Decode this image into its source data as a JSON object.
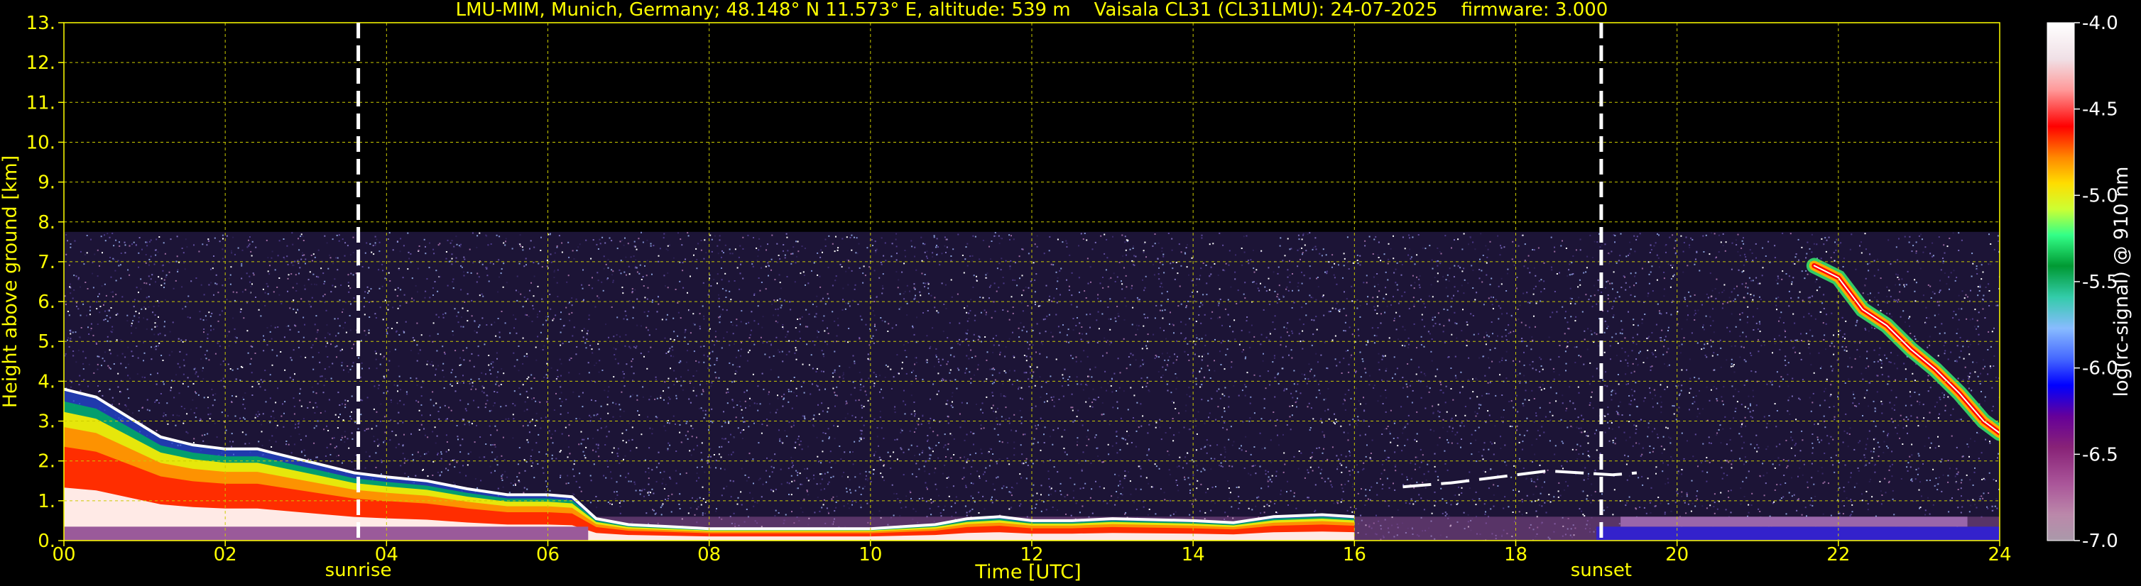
{
  "chart_data": {
    "type": "heatmap",
    "title": "LMU-MIM, Munich, Germany; 48.148° N 11.573° E, altitude: 539 m    Vaisala CL31 (CL31LMU): 24-07-2025    firmware: 3.000",
    "xlabel": "Time [UTC]",
    "ylabel": "Height above ground [km]",
    "xlim": [
      0,
      24
    ],
    "ylim": [
      0,
      13
    ],
    "x_ticks": [
      "00",
      "02",
      "04",
      "06",
      "08",
      "10",
      "12",
      "14",
      "16",
      "18",
      "20",
      "22",
      "24"
    ],
    "y_ticks": [
      "0.",
      "1.",
      "2.",
      "3.",
      "4.",
      "5.",
      "6.",
      "7.",
      "8.",
      "9.",
      "10.",
      "11.",
      "12.",
      "13."
    ],
    "grid": true,
    "annotations": [
      {
        "label": "sunrise",
        "x": 3.65
      },
      {
        "label": "sunset",
        "x": 19.06
      }
    ],
    "colorbar": {
      "label": "log(rc-signal) @ 910 nm",
      "range": [
        -7.0,
        -4.0
      ],
      "ticks": [
        "-4.0",
        "-4.5",
        "-5.0",
        "-5.5",
        "-6.0",
        "-6.5",
        "-7.0"
      ]
    },
    "noise_top_km": 7.75,
    "boundary_layer": [
      [
        0,
        3.8
      ],
      [
        0.4,
        3.6
      ],
      [
        0.8,
        3.1
      ],
      [
        1.2,
        2.6
      ],
      [
        1.6,
        2.4
      ],
      [
        2.0,
        2.3
      ],
      [
        2.4,
        2.3
      ],
      [
        2.8,
        2.1
      ],
      [
        3.2,
        1.9
      ],
      [
        3.6,
        1.7
      ],
      [
        4.0,
        1.6
      ],
      [
        4.5,
        1.5
      ],
      [
        5.0,
        1.3
      ],
      [
        5.5,
        1.15
      ],
      [
        6.0,
        1.15
      ],
      [
        6.3,
        1.1
      ],
      [
        6.6,
        0.55
      ],
      [
        7.0,
        0.4
      ],
      [
        7.5,
        0.35
      ],
      [
        8.0,
        0.3
      ],
      [
        9.0,
        0.3
      ],
      [
        10.0,
        0.3
      ],
      [
        10.8,
        0.4
      ],
      [
        11.2,
        0.55
      ],
      [
        11.6,
        0.6
      ],
      [
        12.0,
        0.5
      ],
      [
        12.5,
        0.5
      ],
      [
        13.0,
        0.55
      ],
      [
        14.0,
        0.5
      ],
      [
        14.5,
        0.45
      ],
      [
        15.0,
        0.6
      ],
      [
        15.6,
        0.65
      ],
      [
        16.0,
        0.6
      ]
    ],
    "residual_layer": [
      [
        16.6,
        1.35
      ],
      [
        17.2,
        1.45
      ],
      [
        17.8,
        1.6
      ],
      [
        18.4,
        1.75
      ],
      [
        18.8,
        1.7
      ],
      [
        19.2,
        1.65
      ],
      [
        19.5,
        1.7
      ]
    ],
    "elevated_layer": [
      [
        21.7,
        6.9
      ],
      [
        22.0,
        6.6
      ],
      [
        22.3,
        5.8
      ],
      [
        22.6,
        5.4
      ],
      [
        22.9,
        4.8
      ],
      [
        23.2,
        4.3
      ],
      [
        23.5,
        3.7
      ],
      [
        23.8,
        3.0
      ],
      [
        24.0,
        2.7
      ]
    ]
  }
}
